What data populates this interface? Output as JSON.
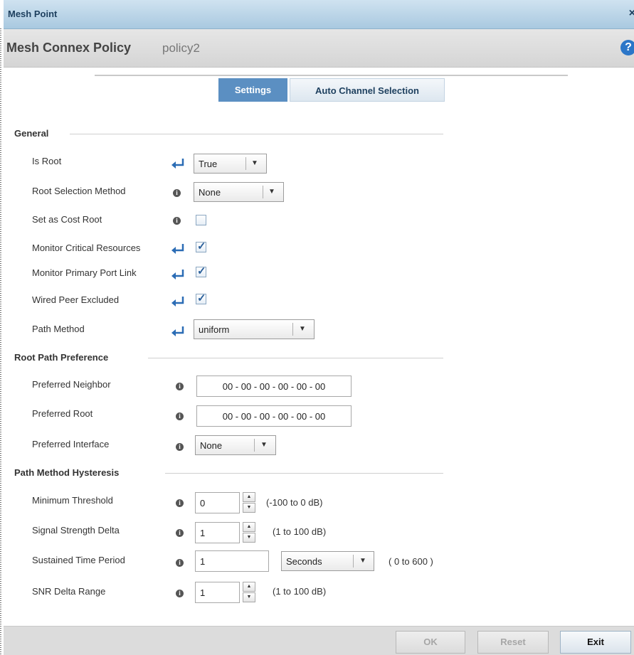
{
  "window": {
    "title": "Mesh Point",
    "close": "×"
  },
  "subheader": {
    "label": "Mesh Connex Policy",
    "value": "policy2",
    "help": "?"
  },
  "tabs": [
    {
      "label": "Settings",
      "active": true
    },
    {
      "label": "Auto Channel Selection",
      "active": false
    }
  ],
  "general": {
    "title": "General",
    "is_root": {
      "label": "Is Root",
      "value": "True"
    },
    "root_selection": {
      "label": "Root Selection Method",
      "value": "None"
    },
    "cost_root": {
      "label": "Set as Cost Root",
      "checked": false
    },
    "monitor_critical": {
      "label": "Monitor Critical Resources",
      "checked": true
    },
    "monitor_primary": {
      "label": "Monitor Primary Port Link",
      "checked": true
    },
    "wired_peer": {
      "label": "Wired Peer Excluded",
      "checked": true
    },
    "path_method": {
      "label": "Path Method",
      "value": "uniform"
    }
  },
  "root_path": {
    "title": "Root Path Preference",
    "preferred_neighbor": {
      "label": "Preferred  Neighbor",
      "value": "00 - 00 - 00 - 00 - 00 - 00"
    },
    "preferred_root": {
      "label": "Preferred Root",
      "value": "00 - 00 - 00 - 00 - 00 - 00"
    },
    "preferred_interface": {
      "label": "Preferred Interface",
      "value": "None"
    }
  },
  "hysteresis": {
    "title": "Path Method Hysteresis",
    "min_threshold": {
      "label": "Minimum Threshold",
      "value": "0",
      "range": "(-100 to 0 dB)"
    },
    "signal_delta": {
      "label": "Signal Strength Delta",
      "value": "1",
      "range": "(1 to 100 dB)"
    },
    "sustained": {
      "label": "Sustained Time Period",
      "value": "1",
      "unit": "Seconds",
      "range": "( 0 to 600 )"
    },
    "snr_delta": {
      "label": "SNR Delta Range",
      "value": "1",
      "range": "(1 to 100 dB)"
    }
  },
  "footer": {
    "ok": "OK",
    "reset": "Reset",
    "exit": "Exit"
  },
  "icons": {
    "inherit": "inherit-arrow-icon",
    "info": "info-icon",
    "caret": "caret-down-icon"
  },
  "colors": {
    "title_bar": "#a9c9e0",
    "active_tab": "#5b8fc2",
    "help": "#2b76c8",
    "check": "#2a5f9a"
  }
}
